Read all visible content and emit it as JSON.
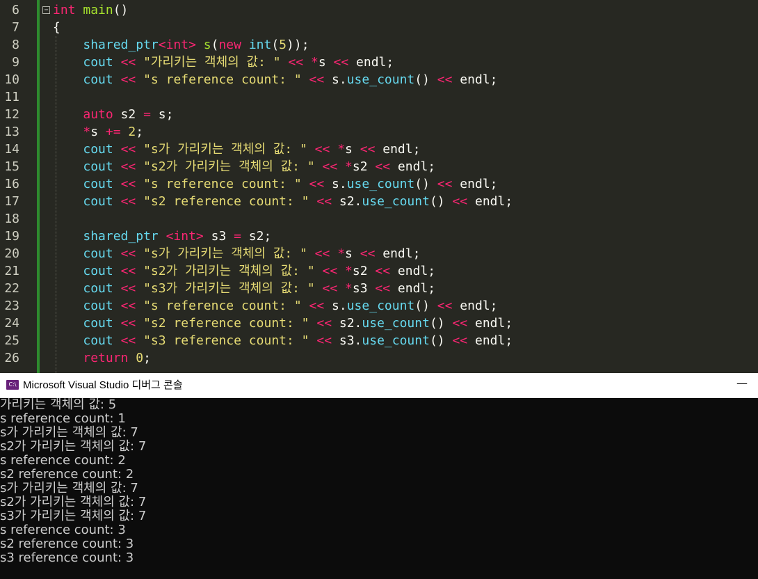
{
  "editor": {
    "lines": [
      {
        "no": "6",
        "tokens": [
          [
            "kw",
            "int"
          ],
          [
            "pl",
            " "
          ],
          [
            "fn",
            "main"
          ],
          [
            "pl",
            "()"
          ]
        ]
      },
      {
        "no": "7",
        "tokens": [
          [
            "pl",
            "{"
          ]
        ]
      },
      {
        "no": "8",
        "tokens": [
          [
            "pl",
            "    "
          ],
          [
            "ty",
            "shared_ptr"
          ],
          [
            "kw",
            "<int>"
          ],
          [
            "pl",
            " "
          ],
          [
            "fn",
            "s"
          ],
          [
            "pl",
            "("
          ],
          [
            "kw",
            "new"
          ],
          [
            "pl",
            " "
          ],
          [
            "ty",
            "int"
          ],
          [
            "pl",
            "("
          ],
          [
            "num",
            "5"
          ],
          [
            "pl",
            "));"
          ]
        ]
      },
      {
        "no": "9",
        "tokens": [
          [
            "pl",
            "    "
          ],
          [
            "ty",
            "cout"
          ],
          [
            "pl",
            " "
          ],
          [
            "op",
            "<<"
          ],
          [
            "pl",
            " "
          ],
          [
            "str",
            "\"가리키는 객체의 값: \""
          ],
          [
            "pl",
            " "
          ],
          [
            "op",
            "<<"
          ],
          [
            "pl",
            " "
          ],
          [
            "op",
            "*"
          ],
          [
            "pl",
            "s "
          ],
          [
            "op",
            "<<"
          ],
          [
            "pl",
            " endl;"
          ]
        ]
      },
      {
        "no": "10",
        "tokens": [
          [
            "pl",
            "    "
          ],
          [
            "ty",
            "cout"
          ],
          [
            "pl",
            " "
          ],
          [
            "op",
            "<<"
          ],
          [
            "pl",
            " "
          ],
          [
            "str",
            "\"s reference count: \""
          ],
          [
            "pl",
            " "
          ],
          [
            "op",
            "<<"
          ],
          [
            "pl",
            " s."
          ],
          [
            "ty",
            "use_count"
          ],
          [
            "pl",
            "() "
          ],
          [
            "op",
            "<<"
          ],
          [
            "pl",
            " endl;"
          ]
        ]
      },
      {
        "no": "11",
        "tokens": []
      },
      {
        "no": "12",
        "tokens": [
          [
            "pl",
            "    "
          ],
          [
            "kw",
            "auto"
          ],
          [
            "pl",
            " s2 "
          ],
          [
            "op",
            "="
          ],
          [
            "pl",
            " s;"
          ]
        ]
      },
      {
        "no": "13",
        "tokens": [
          [
            "pl",
            "    "
          ],
          [
            "op",
            "*"
          ],
          [
            "pl",
            "s "
          ],
          [
            "op",
            "+="
          ],
          [
            "pl",
            " "
          ],
          [
            "num",
            "2"
          ],
          [
            "pl",
            ";"
          ]
        ]
      },
      {
        "no": "14",
        "tokens": [
          [
            "pl",
            "    "
          ],
          [
            "ty",
            "cout"
          ],
          [
            "pl",
            " "
          ],
          [
            "op",
            "<<"
          ],
          [
            "pl",
            " "
          ],
          [
            "str",
            "\"s가 가리키는 객체의 값: \""
          ],
          [
            "pl",
            " "
          ],
          [
            "op",
            "<<"
          ],
          [
            "pl",
            " "
          ],
          [
            "op",
            "*"
          ],
          [
            "pl",
            "s "
          ],
          [
            "op",
            "<<"
          ],
          [
            "pl",
            " endl;"
          ]
        ]
      },
      {
        "no": "15",
        "tokens": [
          [
            "pl",
            "    "
          ],
          [
            "ty",
            "cout"
          ],
          [
            "pl",
            " "
          ],
          [
            "op",
            "<<"
          ],
          [
            "pl",
            " "
          ],
          [
            "str",
            "\"s2가 가리키는 객체의 값: \""
          ],
          [
            "pl",
            " "
          ],
          [
            "op",
            "<<"
          ],
          [
            "pl",
            " "
          ],
          [
            "op",
            "*"
          ],
          [
            "pl",
            "s2 "
          ],
          [
            "op",
            "<<"
          ],
          [
            "pl",
            " endl;"
          ]
        ]
      },
      {
        "no": "16",
        "tokens": [
          [
            "pl",
            "    "
          ],
          [
            "ty",
            "cout"
          ],
          [
            "pl",
            " "
          ],
          [
            "op",
            "<<"
          ],
          [
            "pl",
            " "
          ],
          [
            "str",
            "\"s reference count: \""
          ],
          [
            "pl",
            " "
          ],
          [
            "op",
            "<<"
          ],
          [
            "pl",
            " s."
          ],
          [
            "ty",
            "use_count"
          ],
          [
            "pl",
            "() "
          ],
          [
            "op",
            "<<"
          ],
          [
            "pl",
            " endl;"
          ]
        ]
      },
      {
        "no": "17",
        "tokens": [
          [
            "pl",
            "    "
          ],
          [
            "ty",
            "cout"
          ],
          [
            "pl",
            " "
          ],
          [
            "op",
            "<<"
          ],
          [
            "pl",
            " "
          ],
          [
            "str",
            "\"s2 reference count: \""
          ],
          [
            "pl",
            " "
          ],
          [
            "op",
            "<<"
          ],
          [
            "pl",
            " s2."
          ],
          [
            "ty",
            "use_count"
          ],
          [
            "pl",
            "() "
          ],
          [
            "op",
            "<<"
          ],
          [
            "pl",
            " endl;"
          ]
        ]
      },
      {
        "no": "18",
        "tokens": []
      },
      {
        "no": "19",
        "tokens": [
          [
            "pl",
            "    "
          ],
          [
            "ty",
            "shared_ptr"
          ],
          [
            "pl",
            " "
          ],
          [
            "kw",
            "<int>"
          ],
          [
            "pl",
            " s3 "
          ],
          [
            "op",
            "="
          ],
          [
            "pl",
            " s2;"
          ]
        ]
      },
      {
        "no": "20",
        "tokens": [
          [
            "pl",
            "    "
          ],
          [
            "ty",
            "cout"
          ],
          [
            "pl",
            " "
          ],
          [
            "op",
            "<<"
          ],
          [
            "pl",
            " "
          ],
          [
            "str",
            "\"s가 가리키는 객체의 값: \""
          ],
          [
            "pl",
            " "
          ],
          [
            "op",
            "<<"
          ],
          [
            "pl",
            " "
          ],
          [
            "op",
            "*"
          ],
          [
            "pl",
            "s "
          ],
          [
            "op",
            "<<"
          ],
          [
            "pl",
            " endl;"
          ]
        ]
      },
      {
        "no": "21",
        "tokens": [
          [
            "pl",
            "    "
          ],
          [
            "ty",
            "cout"
          ],
          [
            "pl",
            " "
          ],
          [
            "op",
            "<<"
          ],
          [
            "pl",
            " "
          ],
          [
            "str",
            "\"s2가 가리키는 객체의 값: \""
          ],
          [
            "pl",
            " "
          ],
          [
            "op",
            "<<"
          ],
          [
            "pl",
            " "
          ],
          [
            "op",
            "*"
          ],
          [
            "pl",
            "s2 "
          ],
          [
            "op",
            "<<"
          ],
          [
            "pl",
            " endl;"
          ]
        ]
      },
      {
        "no": "22",
        "tokens": [
          [
            "pl",
            "    "
          ],
          [
            "ty",
            "cout"
          ],
          [
            "pl",
            " "
          ],
          [
            "op",
            "<<"
          ],
          [
            "pl",
            " "
          ],
          [
            "str",
            "\"s3가 가리키는 객체의 값: \""
          ],
          [
            "pl",
            " "
          ],
          [
            "op",
            "<<"
          ],
          [
            "pl",
            " "
          ],
          [
            "op",
            "*"
          ],
          [
            "pl",
            "s3 "
          ],
          [
            "op",
            "<<"
          ],
          [
            "pl",
            " endl;"
          ]
        ]
      },
      {
        "no": "23",
        "tokens": [
          [
            "pl",
            "    "
          ],
          [
            "ty",
            "cout"
          ],
          [
            "pl",
            " "
          ],
          [
            "op",
            "<<"
          ],
          [
            "pl",
            " "
          ],
          [
            "str",
            "\"s reference count: \""
          ],
          [
            "pl",
            " "
          ],
          [
            "op",
            "<<"
          ],
          [
            "pl",
            " s."
          ],
          [
            "ty",
            "use_count"
          ],
          [
            "pl",
            "() "
          ],
          [
            "op",
            "<<"
          ],
          [
            "pl",
            " endl;"
          ]
        ]
      },
      {
        "no": "24",
        "tokens": [
          [
            "pl",
            "    "
          ],
          [
            "ty",
            "cout"
          ],
          [
            "pl",
            " "
          ],
          [
            "op",
            "<<"
          ],
          [
            "pl",
            " "
          ],
          [
            "str",
            "\"s2 reference count: \""
          ],
          [
            "pl",
            " "
          ],
          [
            "op",
            "<<"
          ],
          [
            "pl",
            " s2."
          ],
          [
            "ty",
            "use_count"
          ],
          [
            "pl",
            "() "
          ],
          [
            "op",
            "<<"
          ],
          [
            "pl",
            " endl;"
          ]
        ]
      },
      {
        "no": "25",
        "tokens": [
          [
            "pl",
            "    "
          ],
          [
            "ty",
            "cout"
          ],
          [
            "pl",
            " "
          ],
          [
            "op",
            "<<"
          ],
          [
            "pl",
            " "
          ],
          [
            "str",
            "\"s3 reference count: \""
          ],
          [
            "pl",
            " "
          ],
          [
            "op",
            "<<"
          ],
          [
            "pl",
            " s3."
          ],
          [
            "ty",
            "use_count"
          ],
          [
            "pl",
            "() "
          ],
          [
            "op",
            "<<"
          ],
          [
            "pl",
            " endl;"
          ]
        ]
      },
      {
        "no": "26",
        "tokens": [
          [
            "pl",
            "    "
          ],
          [
            "kw",
            "return"
          ],
          [
            "pl",
            " "
          ],
          [
            "num",
            "0"
          ],
          [
            "pl",
            ";"
          ]
        ]
      }
    ],
    "colors": {
      "kw": "#f92672",
      "ty": "#66d9ef",
      "fn": "#a6e22e",
      "str": "#e6db74",
      "num": "#e6db74",
      "op": "#f92672",
      "pl": "#f8f8f2",
      "background": "#272822",
      "fold_bar": "#2e8b2e"
    }
  },
  "console_window": {
    "title": "Microsoft Visual Studio 디버그 콘솔",
    "icon_label": "C:\\",
    "minimize_glyph": "—",
    "output_lines": [
      "가리키는 객체의 값: 5",
      "s reference count: 1",
      "s가 가리키는 객체의 값: 7",
      "s2가 가리키는 객체의 값: 7",
      "s reference count: 2",
      "s2 reference count: 2",
      "s가 가리키는 객체의 값: 7",
      "s2가 가리키는 객체의 값: 7",
      "s3가 가리키는 객체의 값: 7",
      "s reference count: 3",
      "s2 reference count: 3",
      "s3 reference count: 3"
    ]
  }
}
